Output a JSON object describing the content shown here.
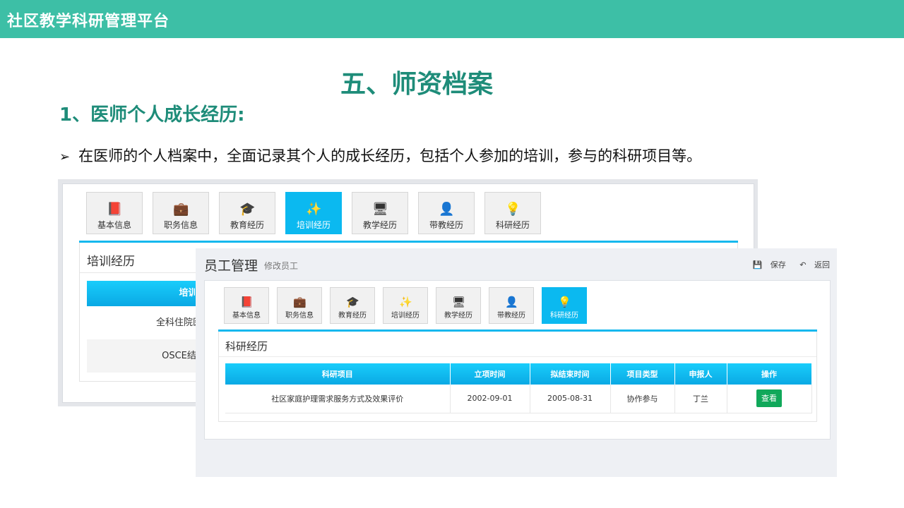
{
  "header": {
    "app_title": "社区教学科研管理平台"
  },
  "slide": {
    "title": "五、师资档案",
    "section": "1、医师个人成长经历:",
    "bullet": "在医师的个人档案中，全面记录其个人的成长经历，包括个人参加的培训，参与的科研项目等。",
    "bullet_marker": "➢"
  },
  "screenshot_back": {
    "tabs": [
      {
        "label": "基本信息",
        "icon": "book-icon",
        "glyph": "📕",
        "active": false
      },
      {
        "label": "职务信息",
        "icon": "briefcase-icon",
        "glyph": "💼",
        "active": false
      },
      {
        "label": "教育经历",
        "icon": "graduation-cap-icon",
        "glyph": "🎓",
        "active": false
      },
      {
        "label": "培训经历",
        "icon": "magic-wand-icon",
        "glyph": "✨",
        "active": true
      },
      {
        "label": "教学经历",
        "icon": "monitor-icon",
        "glyph": "🖥",
        "active": false
      },
      {
        "label": "带教经历",
        "icon": "user-icon",
        "glyph": "👤",
        "active": false
      },
      {
        "label": "科研经历",
        "icon": "lightbulb-icon",
        "glyph": "💡",
        "active": false
      }
    ],
    "panel_title": "培训经历",
    "table_header": "培训课",
    "rows": [
      "全科住院医师岗位",
      "OSCE结构化考"
    ]
  },
  "screenshot_front": {
    "title": "员工管理",
    "subtitle": "修改员工",
    "actions": {
      "save": "保存",
      "back": "返回"
    },
    "tabs": [
      {
        "label": "基本信息",
        "icon": "book-icon",
        "glyph": "📕",
        "active": false
      },
      {
        "label": "职务信息",
        "icon": "briefcase-icon",
        "glyph": "💼",
        "active": false
      },
      {
        "label": "教育经历",
        "icon": "graduation-cap-icon",
        "glyph": "🎓",
        "active": false
      },
      {
        "label": "培训经历",
        "icon": "magic-wand-icon",
        "glyph": "✨",
        "active": false
      },
      {
        "label": "教学经历",
        "icon": "monitor-icon",
        "glyph": "🖥",
        "active": false
      },
      {
        "label": "带教经历",
        "icon": "user-icon",
        "glyph": "👤",
        "active": false
      },
      {
        "label": "科研经历",
        "icon": "lightbulb-icon",
        "glyph": "💡",
        "active": true
      }
    ],
    "panel_title": "科研经历",
    "table": {
      "columns": [
        "科研项目",
        "立项时间",
        "拟结束时间",
        "项目类型",
        "申报人",
        "操作"
      ],
      "rows": [
        {
          "project": "社区家庭护理需求服务方式及效果评价",
          "start": "2002-09-01",
          "end": "2005-08-31",
          "type": "协作参与",
          "applicant": "丁兰",
          "action": "查看"
        }
      ]
    }
  },
  "colors": {
    "header_bg": "#3dbfa6",
    "heading": "#1e8c79",
    "tab_active": "#0bb9f0",
    "view_button": "#10a85a"
  }
}
